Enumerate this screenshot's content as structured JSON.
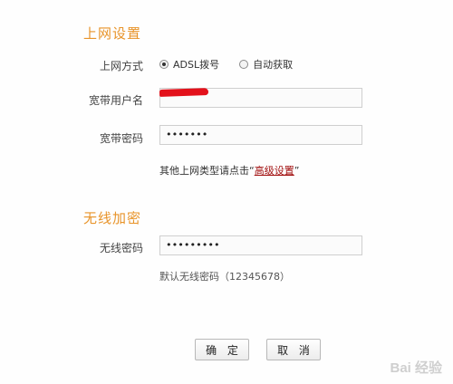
{
  "internet": {
    "section_title": "上网设置",
    "mode_label": "上网方式",
    "mode_options": [
      {
        "label": "ADSL拨号",
        "checked": true
      },
      {
        "label": "自动获取",
        "checked": false
      }
    ],
    "username_label": "宽带用户名",
    "username_value": "",
    "password_label": "宽带密码",
    "password_value": "•••••••",
    "advanced_hint_prefix": "其他上网类型请点击“",
    "advanced_link": "高级设置",
    "advanced_hint_suffix": "”"
  },
  "wireless": {
    "section_title": "无线加密",
    "password_label": "无线密码",
    "password_value": "•••••••••",
    "default_hint": "默认无线密码（12345678）"
  },
  "actions": {
    "confirm_label": "确 定",
    "cancel_label": "取 消"
  },
  "watermark": {
    "text": "Bai 经验"
  },
  "colors": {
    "section_title": "#e8942a",
    "link": "#a10e0e",
    "redaction": "#e3111b"
  }
}
